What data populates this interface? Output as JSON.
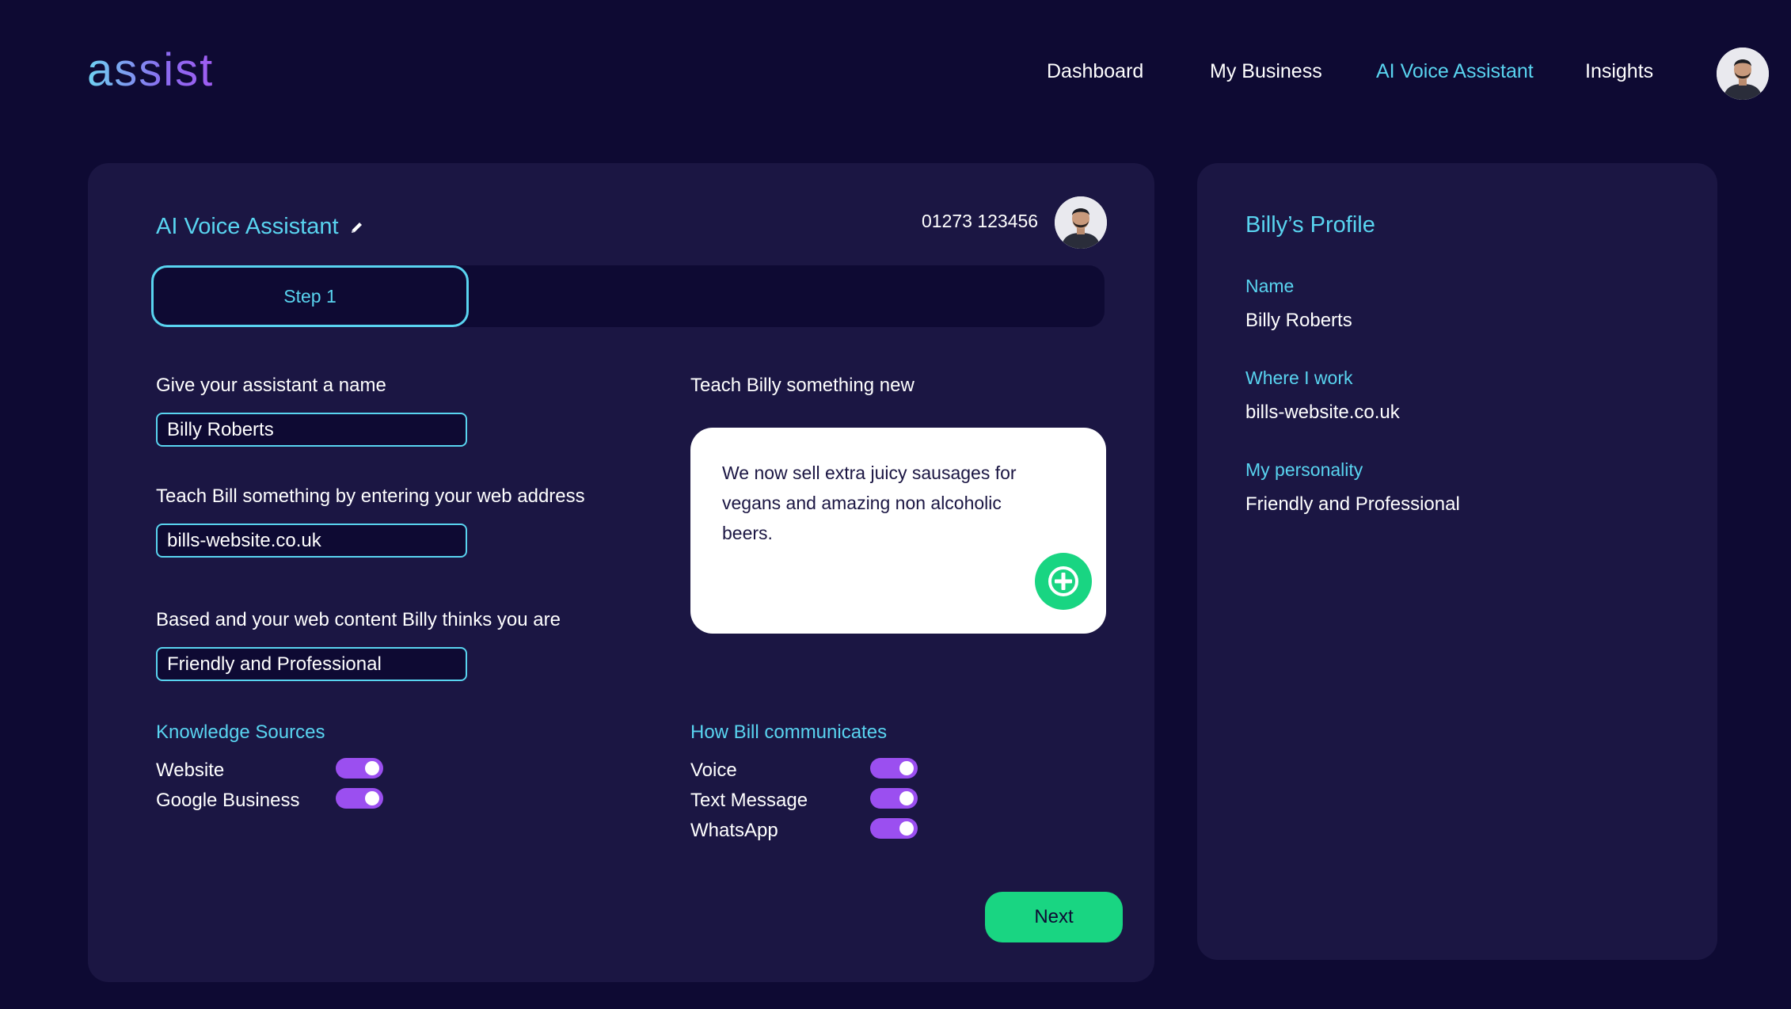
{
  "header": {
    "logo": "assist",
    "nav": [
      {
        "label": "Dashboard",
        "active": false
      },
      {
        "label": "My Business",
        "active": false
      },
      {
        "label": "AI Voice Assistant",
        "active": true
      },
      {
        "label": "Insights",
        "active": false
      }
    ]
  },
  "main": {
    "title": "AI Voice Assistant",
    "phone": "01273 123456",
    "step_label": "Step 1",
    "name_label": "Give your assistant a name",
    "name_value": "Billy Roberts",
    "web_label": "Teach Bill something by entering your web address",
    "web_value": "bills-website.co.uk",
    "personality_label": "Based and your web content Billy thinks you are",
    "personality_value": "Friendly and Professional",
    "teach_label": "Teach Billy something new",
    "teach_text": "We now sell extra juicy sausages for vegans and amazing non alcoholic beers.",
    "knowledge": {
      "title": "Knowledge Sources",
      "items": [
        {
          "label": "Website",
          "on": true
        },
        {
          "label": "Google Business",
          "on": true
        }
      ]
    },
    "communicates": {
      "title": "How Bill communicates",
      "items": [
        {
          "label": "Voice",
          "on": true
        },
        {
          "label": "Text Message",
          "on": true
        },
        {
          "label": "WhatsApp",
          "on": true
        }
      ]
    },
    "next_label": "Next"
  },
  "profile": {
    "title": "Billy’s Profile",
    "name_label": "Name",
    "name_value": "Billy Roberts",
    "work_label": "Where I work",
    "work_value": "bills-website.co.uk",
    "personality_label": "My personality",
    "personality_value": "Friendly and Professional"
  },
  "colors": {
    "background": "#0e0a33",
    "card": "#1b1643",
    "accent": "#59d4f0",
    "toggle": "#9b4ff0",
    "success": "#19d582"
  },
  "icons": [
    "pencil-icon",
    "add-icon",
    "avatar-icon"
  ]
}
